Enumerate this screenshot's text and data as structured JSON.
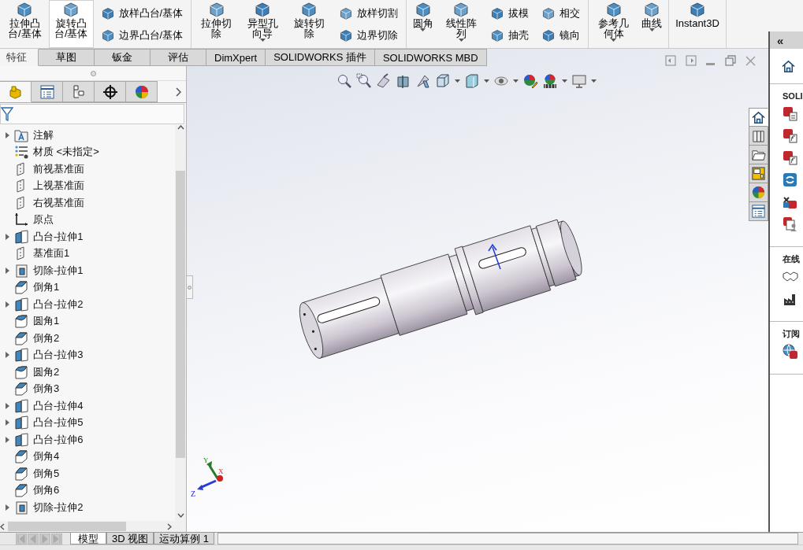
{
  "ribbon": {
    "groups": [
      {
        "items": [
          {
            "kind": "large",
            "label": "拉伸凸台/基体",
            "selected": false,
            "dropdown": false
          },
          {
            "kind": "large",
            "label": "旋转凸台/基体",
            "selected": true,
            "dropdown": false
          },
          {
            "kind": "stack",
            "entries": [
              {
                "label": "放样凸台/基体",
                "selected": false
              },
              {
                "label": "边界凸台/基体",
                "selected": false
              }
            ]
          }
        ]
      },
      {
        "items": [
          {
            "kind": "large",
            "label": "拉伸切除",
            "selected": false,
            "dropdown": false
          },
          {
            "kind": "large",
            "label": "异型孔向导",
            "selected": false,
            "dropdown": true
          },
          {
            "kind": "large",
            "label": "旋转切除",
            "selected": false,
            "dropdown": false
          },
          {
            "kind": "stack",
            "entries": [
              {
                "label": "放样切割",
                "selected": false
              },
              {
                "label": "边界切除",
                "selected": false
              }
            ]
          }
        ]
      },
      {
        "items": [
          {
            "kind": "large",
            "label": "圆角",
            "selected": false,
            "dropdown": true
          },
          {
            "kind": "large",
            "label": "线性阵列",
            "selected": false,
            "dropdown": true
          },
          {
            "kind": "stack",
            "entries": [
              {
                "label": "拔模",
                "selected": false
              },
              {
                "label": "抽壳",
                "selected": false
              }
            ]
          },
          {
            "kind": "stack",
            "entries": [
              {
                "label": "相交",
                "selected": false
              },
              {
                "label": "镜向",
                "selected": false
              }
            ]
          }
        ]
      },
      {
        "items": [
          {
            "kind": "large",
            "label": "参考几何体",
            "selected": false,
            "dropdown": true
          },
          {
            "kind": "large",
            "label": "曲线",
            "selected": false,
            "dropdown": true
          }
        ]
      },
      {
        "items": [
          {
            "kind": "large",
            "label": "Instant3D",
            "selected": false,
            "dropdown": false
          }
        ]
      }
    ]
  },
  "command_tabs": [
    {
      "label": "特征",
      "selected": true
    },
    {
      "label": "草图",
      "selected": false
    },
    {
      "label": "钣金",
      "selected": false
    },
    {
      "label": "评估",
      "selected": false
    },
    {
      "label": "DimXpert",
      "selected": false
    },
    {
      "label": "SOLIDWORKS 插件",
      "selected": false
    },
    {
      "label": "SOLIDWORKS MBD",
      "selected": false
    }
  ],
  "panel_tabs": [
    {
      "selected": true
    },
    {
      "selected": false
    },
    {
      "selected": false
    },
    {
      "selected": false
    },
    {
      "selected": false
    }
  ],
  "feature_tree": [
    {
      "label": "注解",
      "kind": "annotation",
      "collapsible": true
    },
    {
      "label": "材质 <未指定>",
      "kind": "material",
      "collapsible": false
    },
    {
      "label": "前视基准面",
      "kind": "plane",
      "collapsible": false
    },
    {
      "label": "上视基准面",
      "kind": "plane",
      "collapsible": false
    },
    {
      "label": "右视基准面",
      "kind": "plane",
      "collapsible": false
    },
    {
      "label": "原点",
      "kind": "origin",
      "collapsible": false
    },
    {
      "label": "凸台-拉伸1",
      "kind": "boss",
      "collapsible": true
    },
    {
      "label": "基准面1",
      "kind": "plane",
      "collapsible": false
    },
    {
      "label": "切除-拉伸1",
      "kind": "cut",
      "collapsible": true
    },
    {
      "label": "倒角1",
      "kind": "chamfer",
      "collapsible": false
    },
    {
      "label": "凸台-拉伸2",
      "kind": "boss",
      "collapsible": true
    },
    {
      "label": "圆角1",
      "kind": "fillet",
      "collapsible": false
    },
    {
      "label": "倒角2",
      "kind": "chamfer",
      "collapsible": false
    },
    {
      "label": "凸台-拉伸3",
      "kind": "boss",
      "collapsible": true
    },
    {
      "label": "圆角2",
      "kind": "fillet",
      "collapsible": false
    },
    {
      "label": "倒角3",
      "kind": "chamfer",
      "collapsible": false
    },
    {
      "label": "凸台-拉伸4",
      "kind": "boss",
      "collapsible": true
    },
    {
      "label": "凸台-拉伸5",
      "kind": "boss",
      "collapsible": true
    },
    {
      "label": "凸台-拉伸6",
      "kind": "boss",
      "collapsible": true
    },
    {
      "label": "倒角4",
      "kind": "chamfer",
      "collapsible": false
    },
    {
      "label": "倒角5",
      "kind": "chamfer",
      "collapsible": false
    },
    {
      "label": "倒角6",
      "kind": "chamfer",
      "collapsible": false
    },
    {
      "label": "切除-拉伸2",
      "kind": "cut",
      "collapsible": true
    }
  ],
  "triad": {
    "x": "X",
    "y": "Y",
    "z": "Z"
  },
  "task_pane_tabs": [
    {
      "selected": true
    },
    {
      "selected": false
    },
    {
      "selected": false
    },
    {
      "selected": false
    },
    {
      "selected": false
    },
    {
      "selected": false
    }
  ],
  "task_pane": {
    "collapse_label": "«",
    "sections": [
      {
        "heading": "SOLI",
        "items": [
          {
            "kind": "document"
          },
          {
            "kind": "formula"
          },
          {
            "kind": "formula"
          },
          {
            "kind": "sync"
          },
          {
            "kind": "tools"
          },
          {
            "kind": "person"
          }
        ]
      },
      {
        "heading": "在线",
        "items": [
          {
            "kind": "handshake"
          },
          {
            "kind": "factory"
          }
        ]
      },
      {
        "heading": "订阅",
        "items": [
          {
            "kind": "globe"
          }
        ]
      }
    ]
  },
  "bottom_tabs": [
    {
      "label": "模型",
      "selected": true
    },
    {
      "label": "3D 视图",
      "selected": false
    },
    {
      "label": "运动算例 1",
      "selected": false
    }
  ]
}
